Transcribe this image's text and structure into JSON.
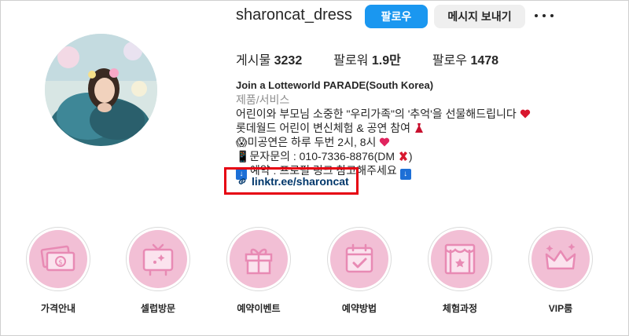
{
  "profile": {
    "username": "sharoncat_dress",
    "follow_label": "팔로우",
    "message_label": "메시지 보내기",
    "stats": {
      "posts_label": "게시물",
      "posts_value": "3232",
      "followers_label": "팔로워",
      "followers_value": "1.9만",
      "following_label": "팔로우",
      "following_value": "1478"
    },
    "bio": {
      "name": "Join a Lotteworld PARADE(South Korea)",
      "category": "제품/서비스",
      "line1": "어린이와 부모님 소중한 \"우리가족\"의 '추억'을 선물해드립니다",
      "line2": "롯데월드 어린이 변신체험 & 공연 참여",
      "line3": "😱미공연은 하루 두번 2시, 8시",
      "line4": "📱문자문의 : 010-7336-8876(DM",
      "line5": "예약 : 프로필 링크 참고해주세요"
    },
    "link": "linktr.ee/sharoncat"
  },
  "highlights": [
    {
      "label": "가격안내",
      "icon": "money-icon"
    },
    {
      "label": "셀럽방문",
      "icon": "tv-icon"
    },
    {
      "label": "예약이벤트",
      "icon": "gift-icon"
    },
    {
      "label": "예약방법",
      "icon": "calendar-check-icon"
    },
    {
      "label": "체험과정",
      "icon": "stage-icon"
    },
    {
      "label": "VIP룸",
      "icon": "crown-icon"
    }
  ],
  "colors": {
    "accent_blue": "#1a97f0",
    "highlight_pink": "#f2bfd5",
    "highlight_icon": "#e88ab4",
    "link_color": "#00376b",
    "annotation_red": "#e60012"
  }
}
